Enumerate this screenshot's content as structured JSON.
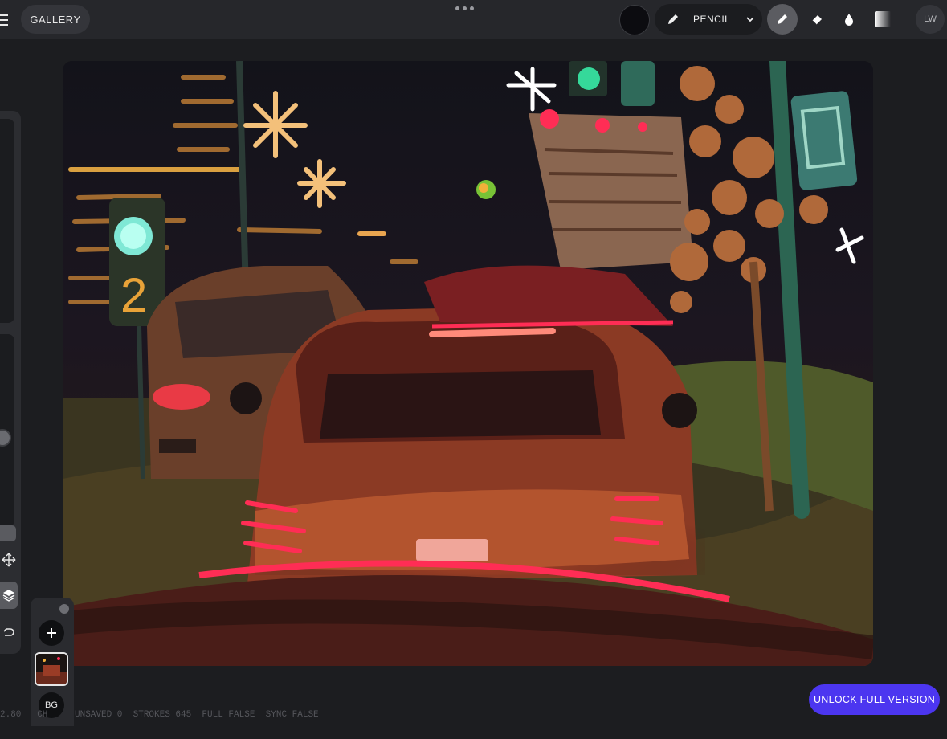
{
  "topbar": {
    "gallery_label": "GALLERY",
    "brush_name": "PENCIL",
    "current_color": "#0c0c10",
    "profile_initials": "LW"
  },
  "tools": [
    "pencil-tool",
    "eraser-tool",
    "smudge-tool",
    "gradient-tool"
  ],
  "layers": {
    "background_label": "BG"
  },
  "status": {
    "left_text": "2.80   CH",
    "right_text": "UNSAVED 0  STROKES 645  FULL FALSE  SYNC FALSE"
  },
  "unlock_label": "UNLOCK FULL VERSION",
  "colors": {
    "accent": "#4c36f0",
    "topbar_bg": "#26272b",
    "app_bg": "#1c1d20"
  }
}
